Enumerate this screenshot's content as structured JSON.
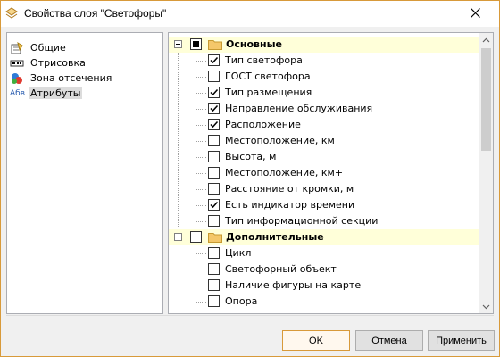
{
  "window": {
    "title": "Свойства слоя \"Светофоры\"",
    "accent_color": "#d89a3a",
    "icons": {
      "app": "layer-properties-icon",
      "close": "close-icon"
    }
  },
  "left_panel": {
    "items": [
      {
        "label": "Общие",
        "icon": "general-icon",
        "selected": false
      },
      {
        "label": "Отрисовка",
        "icon": "render-icon",
        "selected": false
      },
      {
        "label": "Зона отсечения",
        "icon": "clip-zone-icon",
        "selected": false
      },
      {
        "label": "Атрибуты",
        "icon": "attributes-icon",
        "icon_text": "Абв",
        "selected": true
      }
    ]
  },
  "attributes": {
    "groups": [
      {
        "label": "Основные",
        "state": "partial",
        "expanded": true,
        "items": [
          {
            "label": "Тип светофора",
            "checked": true
          },
          {
            "label": "ГОСТ светофора",
            "checked": false
          },
          {
            "label": "Тип размещения",
            "checked": true
          },
          {
            "label": "Направление обслуживания",
            "checked": true
          },
          {
            "label": "Расположение",
            "checked": true
          },
          {
            "label": "Местоположение, км",
            "checked": false
          },
          {
            "label": "Высота, м",
            "checked": false
          },
          {
            "label": "Местоположение, км+",
            "checked": false
          },
          {
            "label": "Расстояние от кромки, м",
            "checked": false
          },
          {
            "label": "Есть индикатор времени",
            "checked": true
          },
          {
            "label": "Тип информационной секции",
            "checked": false
          }
        ]
      },
      {
        "label": "Дополнительные",
        "state": "unchecked",
        "expanded": true,
        "items": [
          {
            "label": "Цикл",
            "checked": false
          },
          {
            "label": "Светофорный объект",
            "checked": false
          },
          {
            "label": "Наличие фигуры на карте",
            "checked": false
          },
          {
            "label": "Опора",
            "checked": false
          }
        ]
      }
    ],
    "group_color": "#ffffd9"
  },
  "buttons": {
    "ok": "OK",
    "cancel": "Отмена",
    "apply": "Применить"
  }
}
